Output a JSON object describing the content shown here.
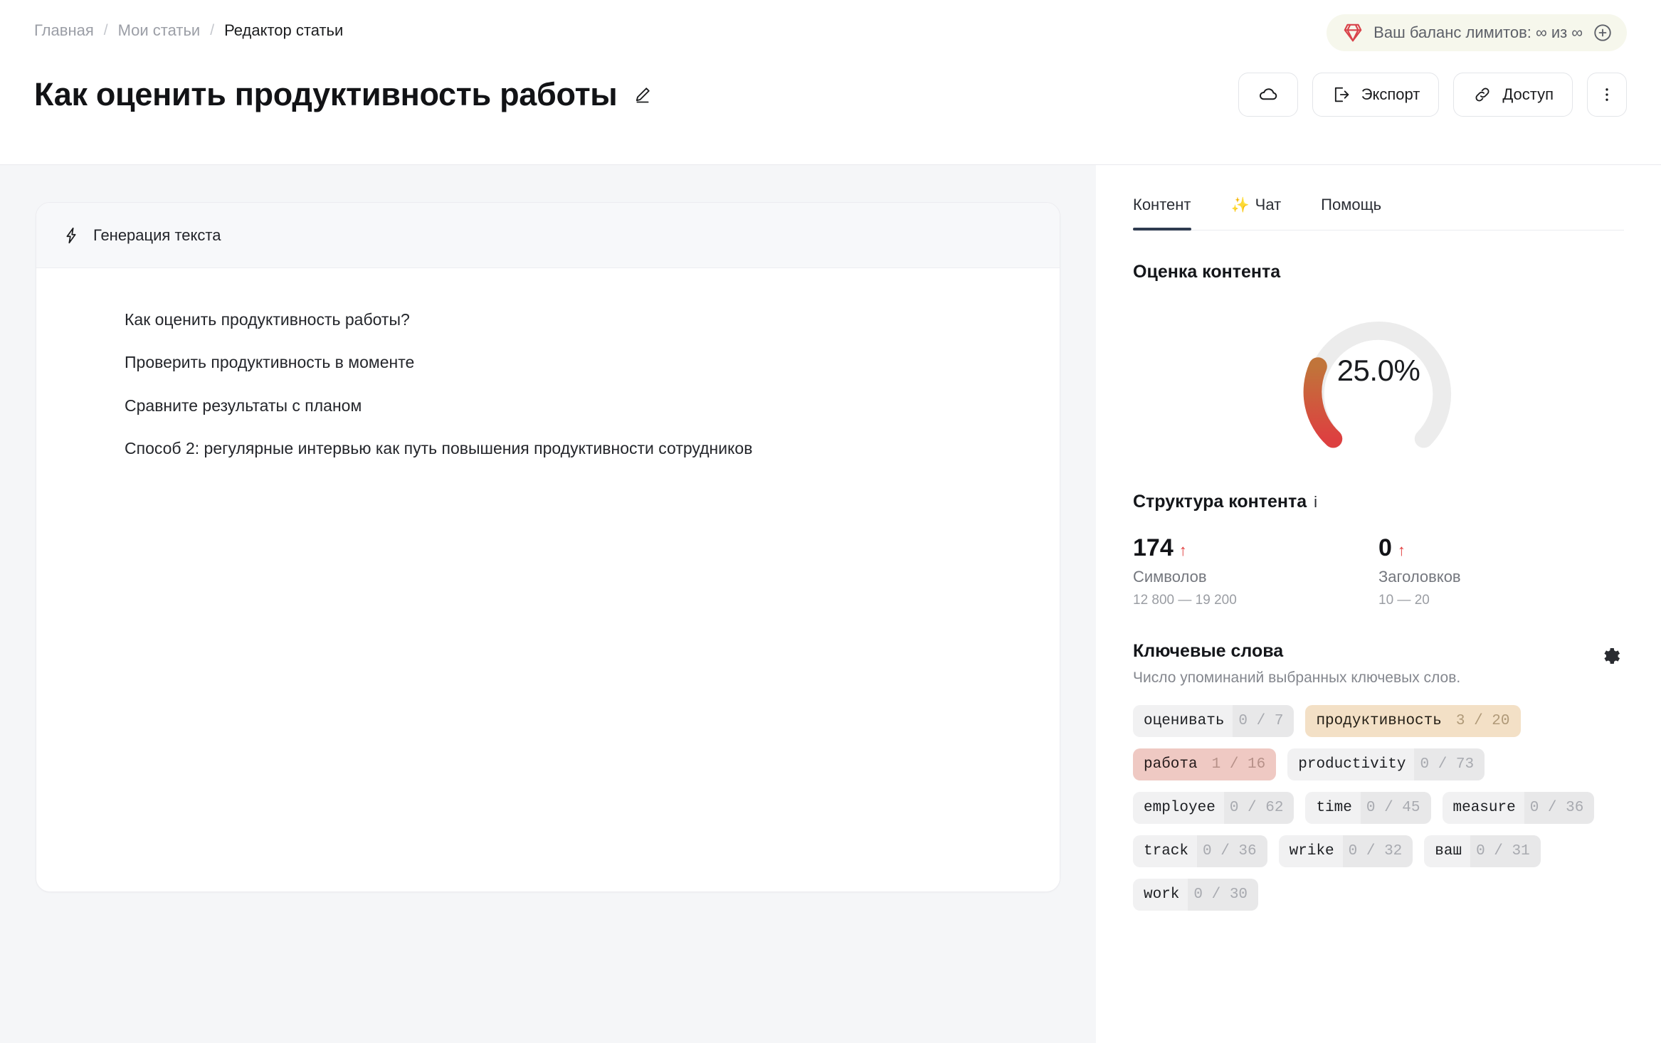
{
  "breadcrumb": {
    "items": [
      {
        "label": "Главная",
        "current": false
      },
      {
        "label": "Мои статьи",
        "current": false
      },
      {
        "label": "Редактор статьи",
        "current": true
      }
    ],
    "separator": "/"
  },
  "balance": {
    "icon": "gem-icon",
    "text": "Ваш баланс лимитов: ∞ из ∞",
    "add_icon": "plus-circle-icon",
    "bg_color": "#f6f7ec",
    "gem_color": "#d9434a"
  },
  "header": {
    "title": "Как оценить продуктивность работы",
    "edit_icon": "pencil-icon",
    "actions": [
      {
        "name": "cloud-save-button",
        "label": "",
        "icon": "cloud-icon"
      },
      {
        "name": "export-button",
        "label": "Экспорт",
        "icon": "export-icon"
      },
      {
        "name": "share-button",
        "label": "Доступ",
        "icon": "link-icon"
      },
      {
        "name": "more-menu-button",
        "label": "",
        "icon": "kebab-icon"
      }
    ]
  },
  "editor": {
    "toolbar_icon": "lightning-icon",
    "toolbar_label": "Генерация текста",
    "lines": [
      "Как оценить продуктивность работы?",
      "Проверить продуктивность в моменте",
      "Сравните результаты с планом",
      "Способ 2: регулярные интервью как путь повышения продуктивности сотрудников"
    ]
  },
  "sidebar": {
    "tabs": [
      {
        "label": "Контент",
        "icon": "",
        "active": true
      },
      {
        "label": "Чат",
        "icon": "✨",
        "active": false
      },
      {
        "label": "Помощь",
        "icon": "",
        "active": false
      }
    ],
    "score": {
      "title": "Оценка контента",
      "value_label": "25.0%",
      "percent": 25,
      "track_color": "#ececec",
      "fill_start_color": "#c1743a",
      "fill_end_color": "#dc3f3f"
    },
    "structure": {
      "title": "Структура контента",
      "info_icon": "info-icon",
      "stats": [
        {
          "value": "174",
          "trend": "↑",
          "label": "Символов",
          "range": "12 800 — 19 200"
        },
        {
          "value": "0",
          "trend": "↑",
          "label": "Заголовков",
          "range": "10 — 20"
        }
      ],
      "trend_color": "#e23b3b"
    },
    "keywords": {
      "title": "Ключевые слова",
      "subtitle": "Число упоминаний выбранных ключевых слов.",
      "settings_icon": "gear-icon",
      "chips": [
        {
          "word": "оценивать",
          "count": "0 / 7",
          "tone": "neutral"
        },
        {
          "word": "продуктивность",
          "count": "3 / 20",
          "tone": "warn"
        },
        {
          "word": "работа",
          "count": "1 / 16",
          "tone": "bad"
        },
        {
          "word": "productivity",
          "count": "0 / 73",
          "tone": "neutral"
        },
        {
          "word": "employee",
          "count": "0 / 62",
          "tone": "neutral"
        },
        {
          "word": "time",
          "count": "0 / 45",
          "tone": "neutral"
        },
        {
          "word": "measure",
          "count": "0 / 36",
          "tone": "neutral"
        },
        {
          "word": "track",
          "count": "0 / 36",
          "tone": "neutral"
        },
        {
          "word": "wrike",
          "count": "0 / 32",
          "tone": "neutral"
        },
        {
          "word": "ваш",
          "count": "0 / 31",
          "tone": "neutral"
        },
        {
          "word": "work",
          "count": "0 / 30",
          "tone": "neutral"
        }
      ]
    }
  }
}
